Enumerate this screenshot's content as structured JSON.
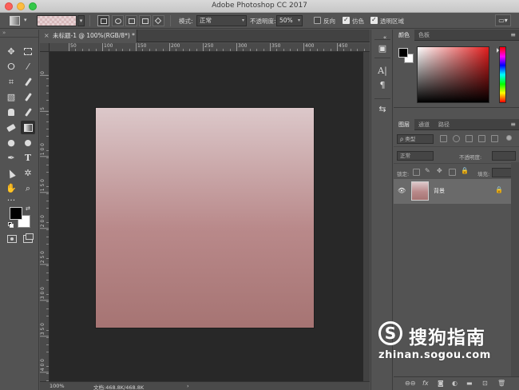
{
  "window": {
    "title": "Adobe Photoshop CC 2017"
  },
  "options_bar": {
    "mode_label": "模式:",
    "mode_value": "正常",
    "opacity_label": "不透明度:",
    "opacity_value": "50%",
    "reverse_label": "反向",
    "dither_label": "仿色",
    "transparency_label": "透明区域",
    "reverse_checked": false,
    "dither_checked": true,
    "transparency_checked": true
  },
  "document": {
    "tab_title": "未标题-1 @ 100%(RGB/8*) *",
    "ruler_h": [
      "50",
      "100",
      "150",
      "200",
      "250",
      "300",
      "350",
      "400",
      "450"
    ],
    "ruler_v": [
      "0",
      "5",
      "1 0 0",
      "1 5 0",
      "2 0 0",
      "2 5 0",
      "3 0 0",
      "3 5 0",
      "4 0 0"
    ],
    "zoom": "100%",
    "doc_size": "文档:468.8K/468.8K",
    "canvas_gradient": [
      "#dcc8ca",
      "#b9898a",
      "#a67473"
    ]
  },
  "color_panel": {
    "tabs": [
      "颜色",
      "色板"
    ],
    "foreground": "#000000",
    "background": "#ffffff"
  },
  "layers_panel": {
    "tabs": [
      "图层",
      "通道",
      "路径"
    ],
    "filter_value": "ρ 类型",
    "blend_mode": "正常",
    "opacity_label": "不透明度:",
    "lock_label": "锁定:",
    "fill_label": "填充:",
    "layers": [
      {
        "name": "背景",
        "visible": true,
        "locked": true
      }
    ]
  },
  "watermark": {
    "brand_cn": "搜狗指南",
    "url": "zhinan.sogou.com"
  }
}
